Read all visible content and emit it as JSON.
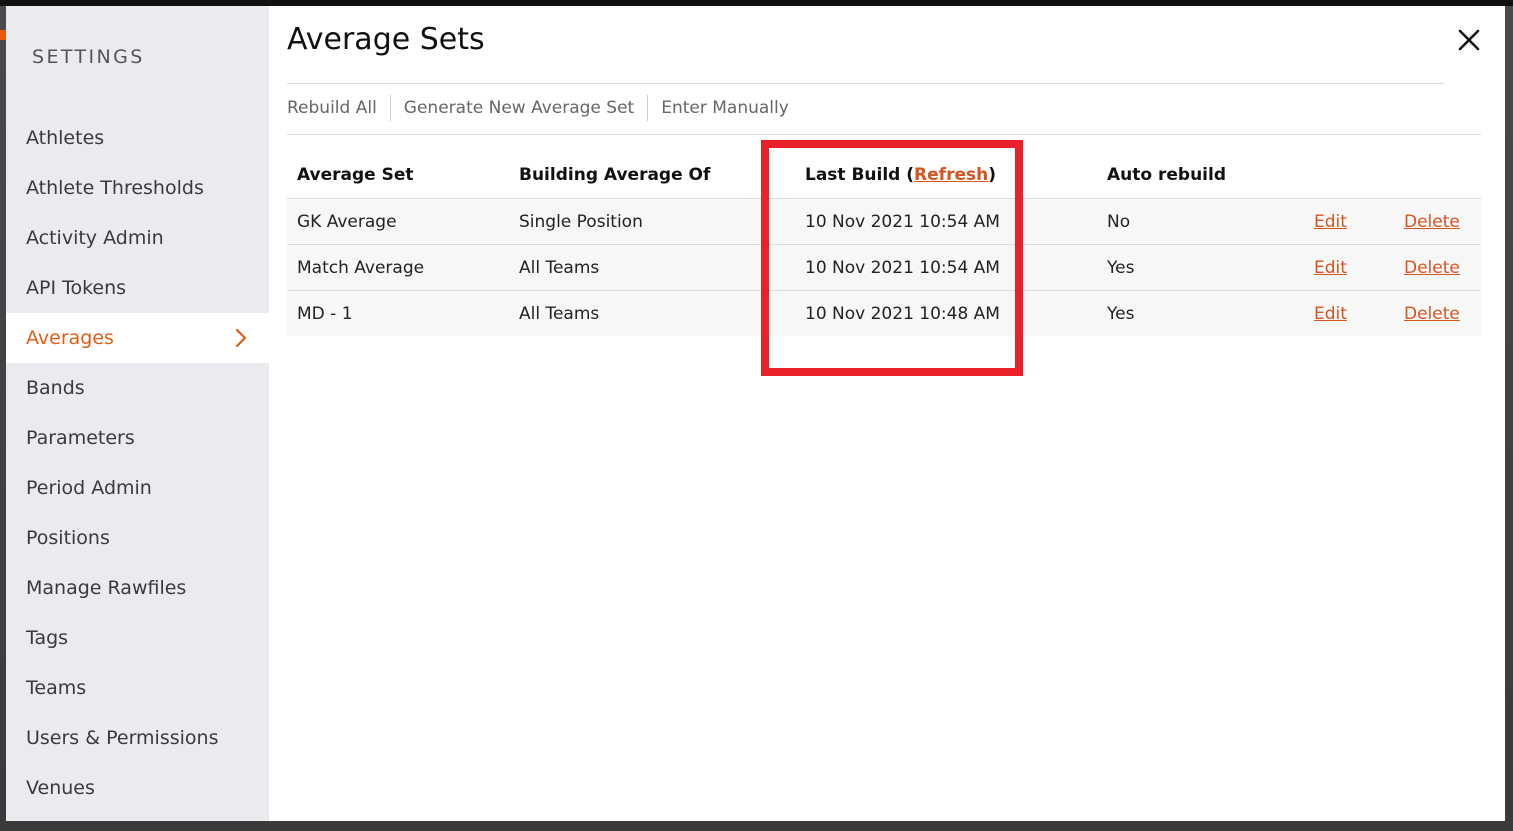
{
  "sidebar": {
    "title": "SETTINGS",
    "items": [
      {
        "label": "Athletes"
      },
      {
        "label": "Athlete Thresholds"
      },
      {
        "label": "Activity Admin"
      },
      {
        "label": "API Tokens"
      },
      {
        "label": "Averages",
        "active": true
      },
      {
        "label": "Bands"
      },
      {
        "label": "Parameters"
      },
      {
        "label": "Period Admin"
      },
      {
        "label": "Positions"
      },
      {
        "label": "Manage Rawfiles"
      },
      {
        "label": "Tags"
      },
      {
        "label": "Teams"
      },
      {
        "label": "Users & Permissions"
      },
      {
        "label": "Venues"
      }
    ]
  },
  "main": {
    "title": "Average Sets",
    "toolbar": {
      "rebuild_all": "Rebuild All",
      "generate_new": "Generate New Average Set",
      "enter_manually": "Enter Manually"
    },
    "table": {
      "headers": {
        "average_set": "Average Set",
        "building_average_of": "Building Average Of",
        "last_build_prefix": "Last Build (",
        "refresh": "Refresh",
        "last_build_suffix": ")",
        "auto_rebuild": "Auto rebuild"
      },
      "rows": [
        {
          "name": "GK Average",
          "building": "Single Position",
          "last_build": "10 Nov 2021 10:54 AM",
          "auto_rebuild": "No",
          "edit": "Edit",
          "delete": "Delete"
        },
        {
          "name": "Match Average",
          "building": "All Teams",
          "last_build": "10 Nov 2021 10:54 AM",
          "auto_rebuild": "Yes",
          "edit": "Edit",
          "delete": "Delete"
        },
        {
          "name": "MD - 1",
          "building": "All Teams",
          "last_build": "10 Nov 2021 10:48 AM",
          "auto_rebuild": "Yes",
          "edit": "Edit",
          "delete": "Delete"
        }
      ]
    }
  },
  "colors": {
    "accent": "#e35d16",
    "link": "#d9531e",
    "highlight_border": "#e8212b",
    "sidebar_bg": "#eaebee"
  },
  "icons": {
    "close": "close-icon",
    "active_chevron": "chevron-right-icon"
  }
}
